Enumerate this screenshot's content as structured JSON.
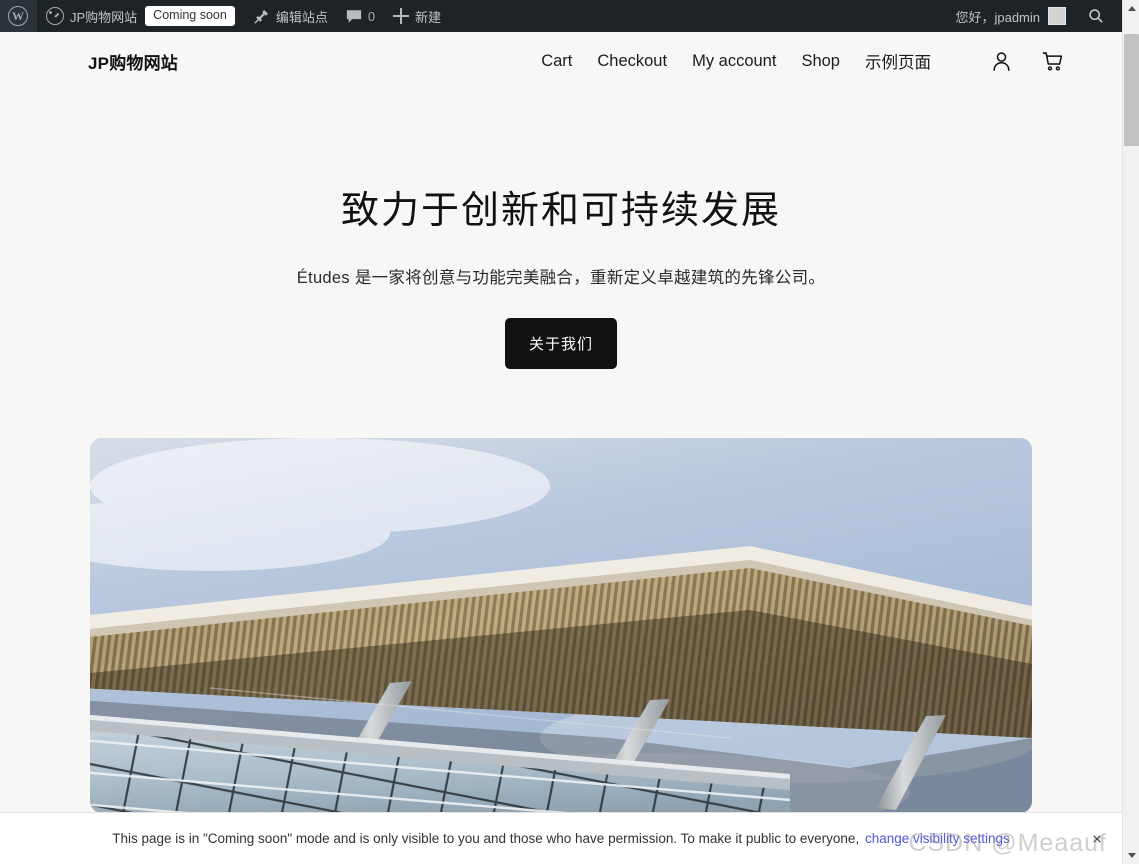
{
  "admin_bar": {
    "wp_logo_name": "wordpress-logo-icon",
    "dashboard_icon_name": "dashboard-icon",
    "site_name": "JP购物网站",
    "coming_soon_badge": "Coming soon",
    "edit_site": "编辑站点",
    "comment_count": "0",
    "new_label": "新建",
    "greeting": "您好，jpadmin",
    "search_icon_name": "search-icon"
  },
  "site_header": {
    "title": "JP购物网站",
    "nav": [
      {
        "label": "Cart"
      },
      {
        "label": "Checkout"
      },
      {
        "label": "My account"
      },
      {
        "label": "Shop"
      },
      {
        "label": "示例页面"
      }
    ],
    "account_icon_name": "person-icon",
    "cart_icon_name": "shopping-cart-icon"
  },
  "hero": {
    "heading": "致力于创新和可持续发展",
    "subtitle": "Études 是一家将创意与功能完美融合，重新定义卓越建筑的先锋公司。",
    "cta_label": "关于我们",
    "image_alt": "现代建筑外观：木格栅遮阳篷与玻璃幕墙"
  },
  "notice": {
    "text": "This page is in \"Coming soon\" mode and is only visible to you and those who have permission. To make it public to everyone,",
    "link_label": "change visibility settings",
    "close_label": "×"
  },
  "watermark": {
    "text": "CSDN @Meaauf"
  },
  "colors": {
    "admin_bar_bg": "#1d2327",
    "page_bg": "#f7f7f6",
    "cta_bg": "#111111",
    "link": "#5454dd",
    "notice_bg": "#ffffff"
  },
  "scrollbar": {
    "up_arrow_name": "scroll-up-arrow",
    "down_arrow_name": "scroll-down-arrow"
  }
}
